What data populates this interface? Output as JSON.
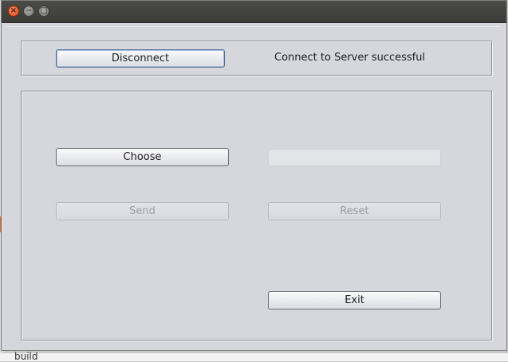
{
  "titlebar": {
    "close_glyph": "×",
    "minimize_glyph": "−",
    "maximize_glyph": "□"
  },
  "connection": {
    "disconnect_label": "Disconnect",
    "status_text": "Connect to Server successful"
  },
  "file": {
    "choose_label": "Choose",
    "path_value": "",
    "send_label": "Send",
    "reset_label": "Reset",
    "send_enabled": false,
    "reset_enabled": false
  },
  "exit_label": "Exit",
  "background": {
    "folder_label": "build"
  },
  "colors": {
    "window_bg": "#d5d7dd",
    "titlebar": "#3f3f3b",
    "close_button": "#e04a1a",
    "desktop_accent": "#e8661d"
  }
}
